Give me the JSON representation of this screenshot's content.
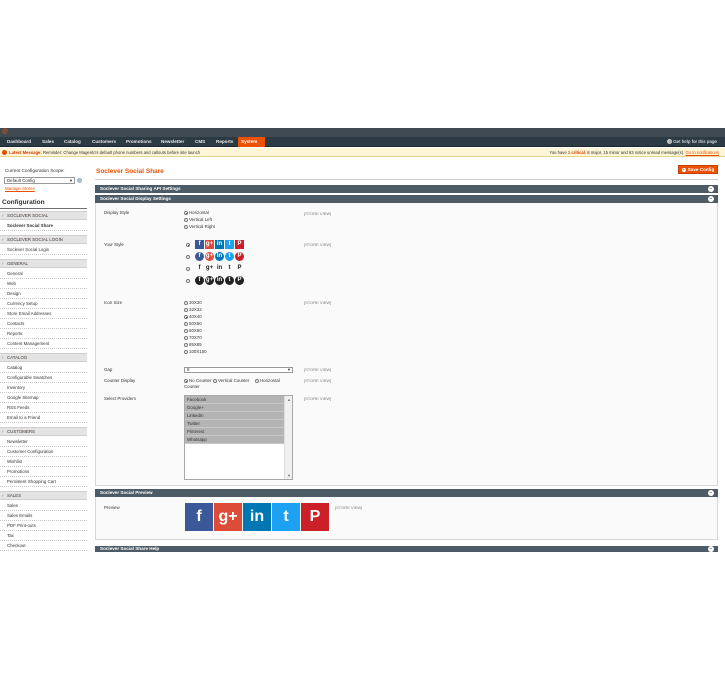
{
  "header": {
    "logo": "@"
  },
  "nav": {
    "items": [
      "Dashboard",
      "Sales",
      "Catalog",
      "Customers",
      "Promotions",
      "Newsletter",
      "CMS",
      "Reports",
      "System"
    ],
    "help": "Get help for this page"
  },
  "message": {
    "latest_label": "Latest Message:",
    "latest_text": "Reminder: Change Magento's default phone numbers and callouts before site launch",
    "summary_prefix": "You have ",
    "critical": "1 critical",
    "summary_suffix": ", 8 major, 15 minor and 63 notice unread message(s).",
    "link": "Go to notifications"
  },
  "sidebar": {
    "scope_label": "Current Configuration Scope:",
    "scope_value": "Default Config",
    "manage_stores": "Manage Stores",
    "title": "Configuration",
    "sections": [
      {
        "label": "SOCLEVER SOCIAL",
        "items": [
          "Soclever Social Share"
        ]
      },
      {
        "label": "SOCLEVER SOCIAL LOGIN",
        "items": [
          "Soclever Social Login"
        ]
      },
      {
        "label": "GENERAL",
        "items": [
          "General",
          "Web",
          "Design",
          "Currency Setup",
          "Store Email Addresses",
          "Contacts",
          "Reports",
          "Content Management"
        ]
      },
      {
        "label": "CATALOG",
        "items": [
          "Catalog",
          "Configurable Swatches",
          "Inventory",
          "Google Sitemap",
          "RSS Feeds",
          "Email to a Friend"
        ]
      },
      {
        "label": "CUSTOMERS",
        "items": [
          "Newsletter",
          "Customer Configuration",
          "Wishlist",
          "Promotions",
          "Persistent Shopping Cart"
        ]
      },
      {
        "label": "SALES",
        "items": [
          "Sales",
          "Sales Emails",
          "PDF Print-outs",
          "Tax",
          "Checkout"
        ]
      }
    ]
  },
  "main": {
    "title": "Soclever Social Share",
    "save": "Save Config",
    "bars": {
      "api": "Soclever Social Sharing API Settings",
      "display": "Soclever Social Display Settings",
      "preview": "Soclever Social Preview",
      "help": "Soclever Social Share Help"
    },
    "store_view": "[STORE VIEW]",
    "display_style": {
      "label": "Display Style",
      "options": [
        "Horizontal",
        "Vertical Left",
        "Vertical Right"
      ]
    },
    "your_style": {
      "label": "Your Style"
    },
    "icon_size": {
      "label": "Icon Size",
      "options": [
        "30X30",
        "32X32",
        "40X40",
        "50X50",
        "60X60",
        "70X70",
        "85X85",
        "100X100"
      ]
    },
    "gap": {
      "label": "Gap",
      "value": "8"
    },
    "counter": {
      "label": "Counter Display",
      "options": [
        "No Counter",
        "Vertical Counter",
        "Horizontal"
      ],
      "wrap": "Counter"
    },
    "providers": {
      "label": "Select Providers",
      "options": [
        "Facebook",
        "Google+",
        "LinkedIn",
        "Twitter",
        "Pinterest",
        "Whatsapp"
      ]
    },
    "preview": {
      "label": "Preview"
    }
  },
  "icon_glyphs": {
    "facebook": "f",
    "google": "g+",
    "linkedin": "in",
    "twitter": "t",
    "pinterest": "P"
  },
  "colors": {
    "accent": "#eb5202",
    "facebook": "#3b5998",
    "google": "#dd4b39",
    "linkedin": "#0077b5",
    "twitter": "#1da1f2",
    "pinterest": "#cb2027"
  }
}
